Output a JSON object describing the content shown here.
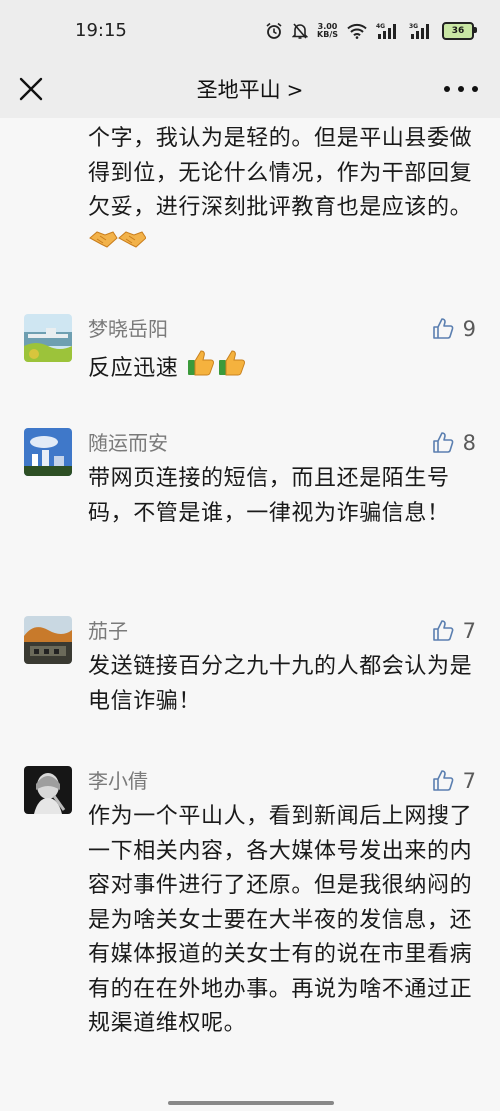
{
  "status_bar": {
    "time": "19:15",
    "speed_value": "3.00",
    "speed_unit": "KB/S",
    "network_1": "4G",
    "network_2": "3G",
    "battery": "36"
  },
  "nav": {
    "title": "圣地平山",
    "chevron": ">"
  },
  "partial_comment": {
    "text": "个字，我认为是轻的。但是平山县委做得到位，无论什么情况，作为干部回复欠妥，进行深刻批评教育也是应该的。",
    "emoji": "handshake-icon ×2"
  },
  "comments": [
    {
      "name": "梦晓岳阳",
      "likes": "9",
      "text": "反应迅速",
      "emoji": "thumbs-up-icon ×2"
    },
    {
      "name": "随运而安",
      "likes": "8",
      "text": "带网页连接的短信，而且还是陌生号码，不管是谁，一律视为诈骗信息！"
    },
    {
      "name": "茄子",
      "likes": "7",
      "text": "发送链接百分之九十九的人都会认为是电信诈骗！"
    },
    {
      "name": "李小倩",
      "likes": "7",
      "text": "作为一个平山人，看到新闻后上网搜了一下相关内容，各大媒体号发出来的内容对事件进行了还原。但是我很纳闷的是为啥关女士要在大半夜的发信息，还有媒体报道的关女士有的说在市里看病有的在在外地办事。再说为啥不通过正规渠道维权呢。"
    }
  ],
  "colors": {
    "background": "#ededed",
    "content_bg": "#f7f7f7",
    "name_gray": "#7a7a7a"
  }
}
